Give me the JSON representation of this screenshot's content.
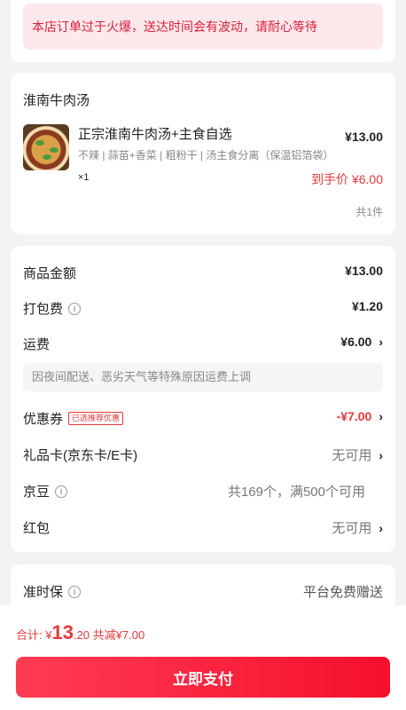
{
  "notice": {
    "text": "本店订单过于火爆，送达时间会有波动，请耐心等待"
  },
  "shop": {
    "name": "淮南牛肉汤",
    "product": {
      "title": "正宗淮南牛肉汤+主食自选",
      "price": "¥13.00",
      "spec": "不辣 | 蒜苗+香菜 | 粗粉干 | 汤主食分离（保温铝箔袋）",
      "qty": "×1",
      "final_label": "到手价",
      "final_price": "¥6.00"
    },
    "item_count": "共1件"
  },
  "fees": {
    "goods_amount": {
      "label": "商品金额",
      "value": "¥13.00"
    },
    "packing_fee": {
      "label": "打包费",
      "value": "¥1.20",
      "icon": "info-icon"
    },
    "shipping": {
      "label": "运费",
      "value": "¥6.00",
      "note": "因夜间配送、恶劣天气等特殊原因运费上调"
    },
    "coupon": {
      "label": "优惠券",
      "tag": "已选推荐优惠",
      "value": "-¥7.00"
    },
    "gift_card": {
      "label": "礼品卡(京东卡/E卡)",
      "value": "无可用"
    },
    "jingdou": {
      "label": "京豆",
      "value": "共169个，满500个可用",
      "icon": "info-icon"
    },
    "red_packet": {
      "label": "红包",
      "value": "无可用"
    }
  },
  "punctual": {
    "label": "准时保",
    "value": "平台免费赠送",
    "icon": "info-icon"
  },
  "summary": {
    "label": "合计:",
    "currency": "¥",
    "amount_int": "13",
    "amount_dec": ".20",
    "saved": "共减¥7.00"
  },
  "pay_button": {
    "label": "立即支付"
  },
  "colors": {
    "accent": "#e4393c",
    "button": "#f5102d",
    "notice_bg": "#fde9ec"
  }
}
